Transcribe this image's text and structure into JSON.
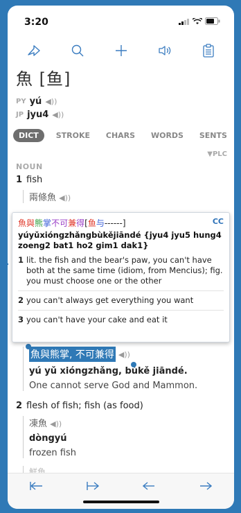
{
  "status": {
    "time": "3:20"
  },
  "toolbar": {
    "buttons": [
      "share-icon",
      "search-icon",
      "add-icon",
      "speaker-icon",
      "clipboard-icon"
    ]
  },
  "entry": {
    "headword": "魚 [鱼]",
    "py_tag": "PY",
    "py": "yú",
    "jp_tag": "JP",
    "jp": "jyu4",
    "speaker": "◀))"
  },
  "tabs": [
    "DICT",
    "STROKE",
    "CHARS",
    "WORDS",
    "SENTS"
  ],
  "plc": "▼PLC",
  "pos": "NOUN",
  "senses": [
    {
      "num": "1",
      "text": "fish",
      "example": "兩條魚"
    },
    {
      "num": "2",
      "text": "flesh of fish; fish (as food)"
    }
  ],
  "popup": {
    "chars": [
      "魚",
      "與",
      "熊",
      "掌",
      "不",
      "可",
      "兼",
      "得",
      "[",
      "鱼",
      "与",
      "------",
      "]"
    ],
    "cc": "CC",
    "pinyin": "yúyǔxióngzhǎngbùkějiāndé {jyu4 jyu5 hung4 zoeng2 bat1 ho2 gim1 dak1}",
    "defs": [
      {
        "n": "1",
        "text": "lit. the fish and the bear's paw, you can't have both at the same time (idiom, from Mencius); fig. you must choose one or the other"
      },
      {
        "n": "2",
        "text": "you can't always get everything you want"
      },
      {
        "n": "3",
        "text": "you can't have your cake and eat it"
      }
    ]
  },
  "example_sel": {
    "hanzi": "魚與熊掌, 不可兼得",
    "pinyin": "yú yǔ xióngzhǎng, bùkě jiāndé.",
    "translation": "One cannot serve God and Mammon."
  },
  "example_3": {
    "hanzi": "凍魚",
    "pinyin": "dòngyú",
    "translation": "frozen fish"
  },
  "cutoff_text": "鮮魚",
  "colors": {
    "frame": "#2f79b6",
    "accent": "#2f79b6",
    "char_red": "#e0392b",
    "char_green": "#2e9e3c",
    "char_blue": "#3b5fd8",
    "char_purple": "#9a3fc7"
  }
}
